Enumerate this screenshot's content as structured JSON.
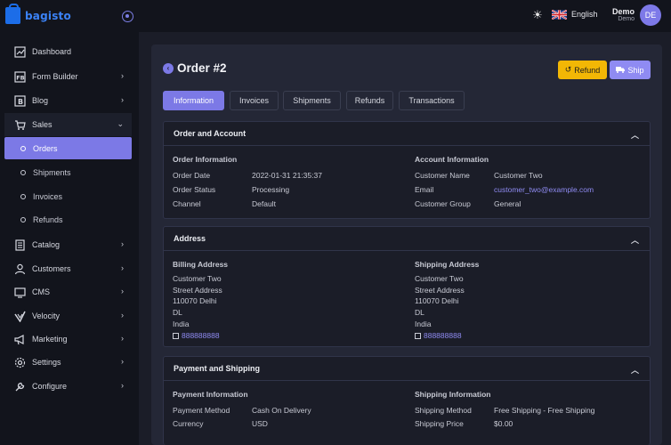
{
  "app": {
    "logo_text": "bagisto"
  },
  "header": {
    "language": "English",
    "user_name": "Demo",
    "user_role": "Demo",
    "avatar_initials": "DE"
  },
  "sidebar": {
    "items": [
      {
        "label": "Dashboard",
        "icon": "dashboard-icon"
      },
      {
        "label": "Form Builder",
        "icon": "form-builder-icon"
      },
      {
        "label": "Blog",
        "icon": "blog-icon"
      },
      {
        "label": "Sales",
        "icon": "sales-icon"
      },
      {
        "label": "Catalog",
        "icon": "catalog-icon"
      },
      {
        "label": "Customers",
        "icon": "customers-icon"
      },
      {
        "label": "CMS",
        "icon": "cms-icon"
      },
      {
        "label": "Velocity",
        "icon": "velocity-icon"
      },
      {
        "label": "Marketing",
        "icon": "marketing-icon"
      },
      {
        "label": "Settings",
        "icon": "settings-icon"
      },
      {
        "label": "Configure",
        "icon": "configure-icon"
      }
    ],
    "sales_sub": [
      "Orders",
      "Shipments",
      "Invoices",
      "Refunds"
    ]
  },
  "page": {
    "title": "Order #2",
    "refund_label": "Refund",
    "ship_label": "Ship",
    "tabs": [
      "Information",
      "Invoices",
      "Shipments",
      "Refunds",
      "Transactions"
    ]
  },
  "order_account": {
    "heading": "Order and Account",
    "order_info_title": "Order Information",
    "order_date_label": "Order Date",
    "order_date": "2022-01-31 21:35:37",
    "order_status_label": "Order Status",
    "order_status": "Processing",
    "channel_label": "Channel",
    "channel": "Default",
    "account_info_title": "Account Information",
    "customer_name_label": "Customer Name",
    "customer_name": "Customer Two",
    "email_label": "Email",
    "email": "customer_two@example.com",
    "customer_group_label": "Customer Group",
    "customer_group": "General"
  },
  "address": {
    "heading": "Address",
    "billing_title": "Billing Address",
    "billing": [
      "Customer Two",
      "Street Address",
      "110070 Delhi",
      "DL",
      "India"
    ],
    "billing_phone": "888888888",
    "shipping_title": "Shipping Address",
    "shipping": [
      "Customer Two",
      "Street Address",
      "110070 Delhi",
      "DL",
      "India"
    ],
    "shipping_phone": "888888888"
  },
  "payment_shipping": {
    "heading": "Payment and Shipping",
    "payment_title": "Payment Information",
    "payment_method_label": "Payment Method",
    "payment_method": "Cash On Delivery",
    "currency_label": "Currency",
    "currency": "USD",
    "shipping_title": "Shipping Information",
    "shipping_method_label": "Shipping Method",
    "shipping_method": "Free Shipping - Free Shipping",
    "shipping_price_label": "Shipping Price",
    "shipping_price": "$0.00"
  },
  "colors": {
    "accent": "#7c79e6",
    "refund": "#f2b705",
    "link": "#8f8bf2"
  }
}
